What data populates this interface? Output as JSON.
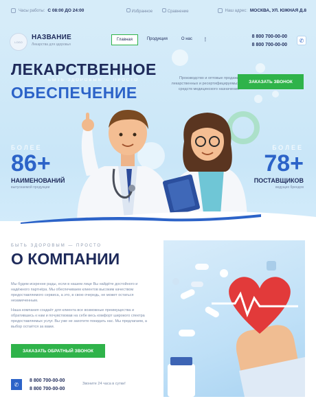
{
  "topbar": {
    "hours_label": "Часы работы:",
    "hours_value": "С 08:00 ДО 24:00",
    "link_favorites": "Избранное",
    "link_compare": "Сравнение",
    "address_label": "Наш адрес:",
    "address_value": "МОСКВА, УЛ. ЮЖНАЯ Д.8"
  },
  "header": {
    "logo_text": "LOGO",
    "brand_name": "НАЗВАНИЕ",
    "brand_tagline": "Лекарства для здоровья",
    "nav": [
      {
        "label": "Главная",
        "active": true
      },
      {
        "label": "Продукция",
        "active": false
      },
      {
        "label": "О нас",
        "active": false
      }
    ],
    "more": "⋮",
    "phones": [
      "8 800 700-00-00",
      "8 800 700-00-00"
    ],
    "phone_icon": "phone-icon"
  },
  "hero": {
    "title_line1": "ЛЕКАРСТВЕННОЕ",
    "title_sub": "БЫТЬ ЗДОРОВЫМ — ПРОСТО",
    "title_line2": "ОБЕСПЕЧЕНИЕ",
    "description": "Производство и оптовые продажи лекарственных и ресертифицируемых средств медицинского назначения",
    "cta": "ЗАКАЗАТЬ ЗВОНОК",
    "stat_left": {
      "more": "БОЛЕЕ",
      "num": "86+",
      "label": "НАИМЕНОВАНИЙ",
      "sub": "выпускаемой продукции"
    },
    "stat_right": {
      "more": "БОЛЕЕ",
      "num": "78+",
      "label": "ПОСТАВЩИКОВ",
      "sub": "ведущих брендов"
    }
  },
  "about": {
    "kicker": "БЫТЬ ЗДОРОВЫМ — ПРОСТО",
    "title": "О КОМПАНИИ",
    "p1": "Мы будем искренне рады, если в нашем лице Вы найдёте достойного и надёжного партнёра. Мы обеспечиваем клиентов высоким качеством предоставляемого сервиса, а это, в свою очередь, не может остаться незамеченным.",
    "p2": "Наша компания создаёт для клиента все возможные преимущества и обратившись к нам и почувствовав на себе весь комфорт широкого спектра предоставляемых услуг. Вы уже не захотите покидать нас. Мы предлагаем, а выбор остаётся за вами.",
    "cta": "ЗАКАЗАТЬ ОБРАТНЫЙ ЗВОНОК",
    "phones": [
      "8 800 700-00-00",
      "8 800 700-00-00"
    ],
    "note": "Звоните 24 часа в сутки!"
  },
  "colors": {
    "accent_blue": "#2c63c8",
    "accent_green": "#2fb34a",
    "navy": "#1e2a5a"
  }
}
